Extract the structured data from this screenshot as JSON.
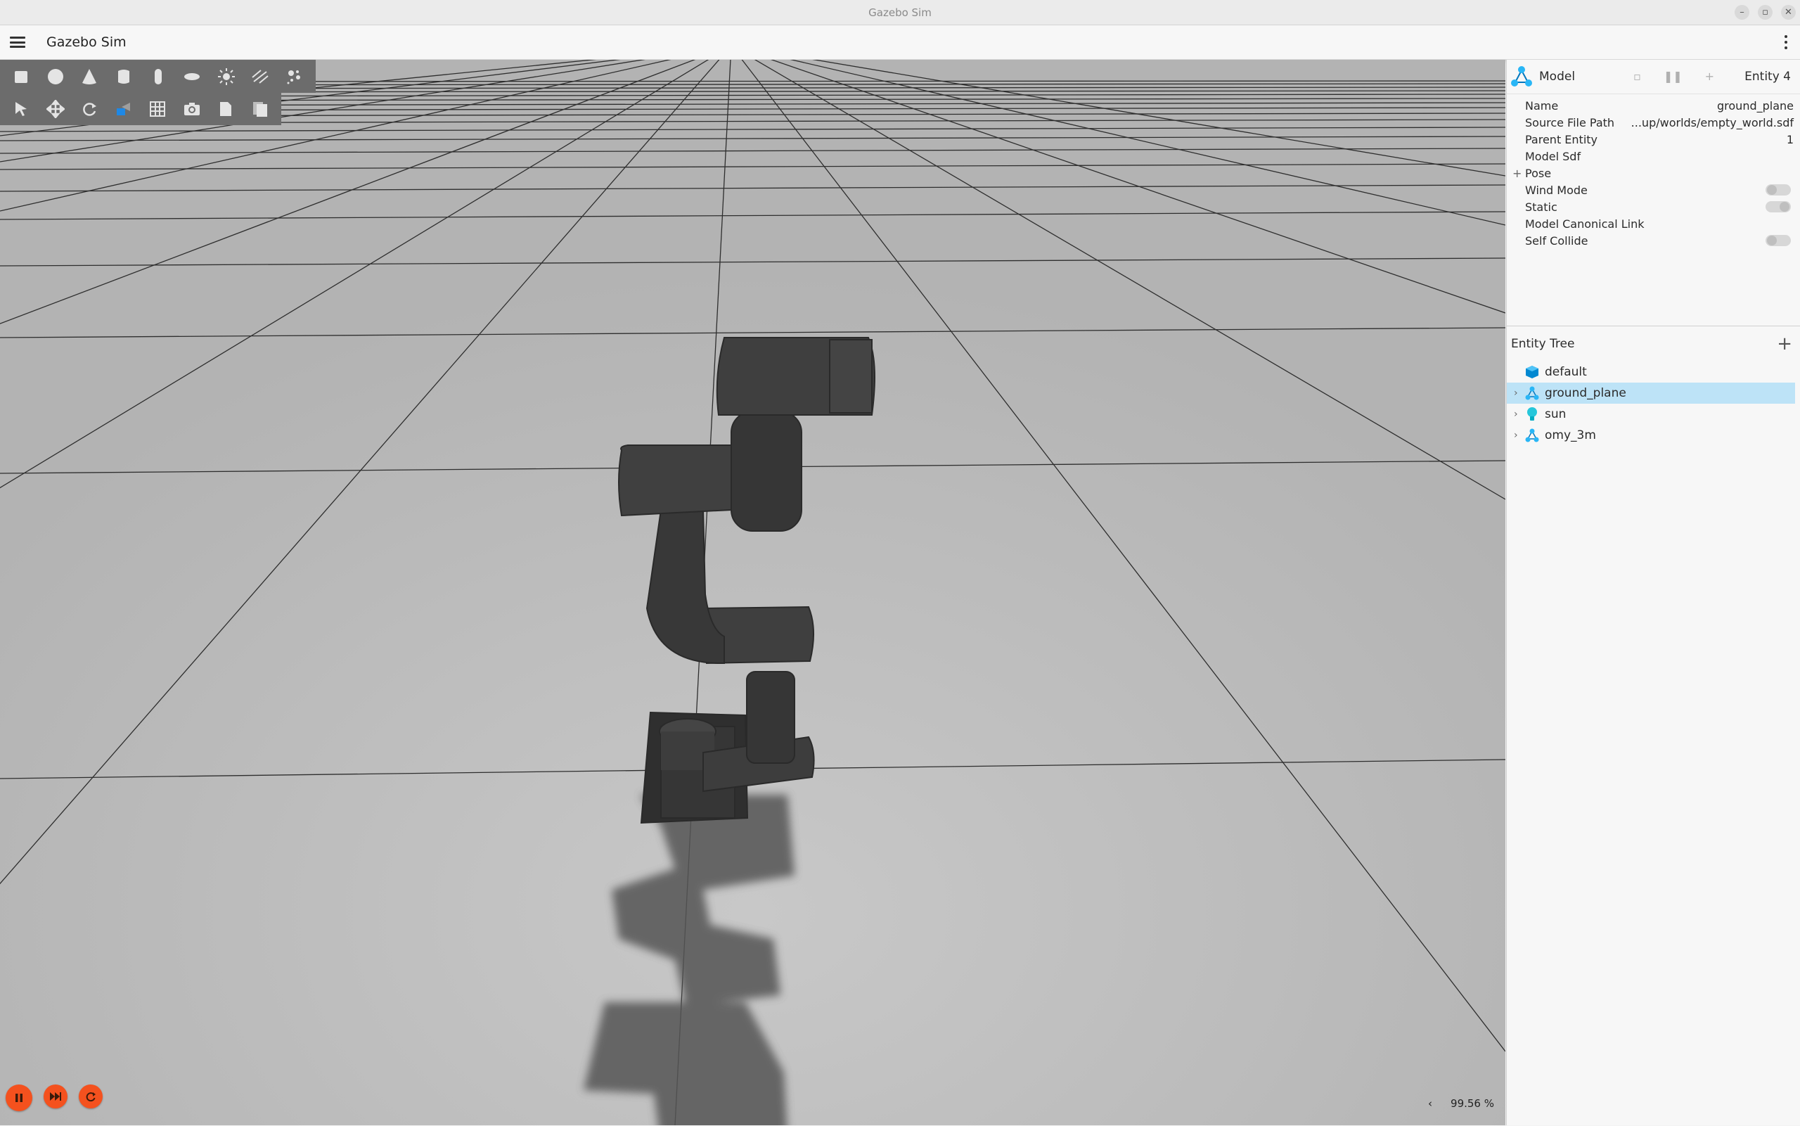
{
  "window": {
    "title": "Gazebo Sim",
    "controls": [
      "–",
      "▫",
      "✕"
    ]
  },
  "appbar": {
    "title": "Gazebo Sim",
    "menu_icon": "hamburger-menu-icon",
    "more_icon": "kebab-menu-icon"
  },
  "toolbar_shapes": [
    "box-icon",
    "sphere-icon",
    "cone-icon",
    "cylinder-icon",
    "capsule-icon",
    "ellipsoid-icon",
    "light-icon",
    "lines-icon",
    "particles-icon"
  ],
  "toolbar_tools": [
    "select-icon",
    "translate-icon",
    "rotate-icon",
    "view-angle-icon",
    "grid-icon",
    "screenshot-icon",
    "copy-icon",
    "paste-icon"
  ],
  "component_inspector": {
    "title": "Model",
    "entity": "Entity 4",
    "properties": [
      {
        "label": "Name",
        "value": "ground_plane"
      },
      {
        "label": "Source File Path",
        "value": "...up/worlds/empty_world.sdf"
      },
      {
        "label": "Parent Entity",
        "value": "1"
      },
      {
        "label": "Model Sdf",
        "value": ""
      }
    ],
    "pose_label": "Pose",
    "toggles": [
      {
        "label": "Wind Mode",
        "state": "off"
      },
      {
        "label": "Static",
        "state": "on"
      },
      {
        "label": "Model Canonical Link",
        "state": "none"
      },
      {
        "label": "Self Collide",
        "state": "off"
      }
    ]
  },
  "entity_tree": {
    "title": "Entity Tree",
    "items": [
      {
        "label": "default",
        "icon": "world-cube-icon",
        "expandable": false,
        "selected": false
      },
      {
        "label": "ground_plane",
        "icon": "model-icon",
        "expandable": true,
        "selected": true
      },
      {
        "label": "sun",
        "icon": "light-bulb-icon",
        "expandable": true,
        "selected": false
      },
      {
        "label": "omy_3m",
        "icon": "model-icon",
        "expandable": true,
        "selected": false
      }
    ]
  },
  "playback": {
    "rtf_value": "99.56 %",
    "collapse_label": "‹"
  },
  "colors": {
    "accent": "#f4511e",
    "selection": "#bde3f7",
    "ground": "#b9b9b9",
    "robot": "#3a3a3a"
  }
}
